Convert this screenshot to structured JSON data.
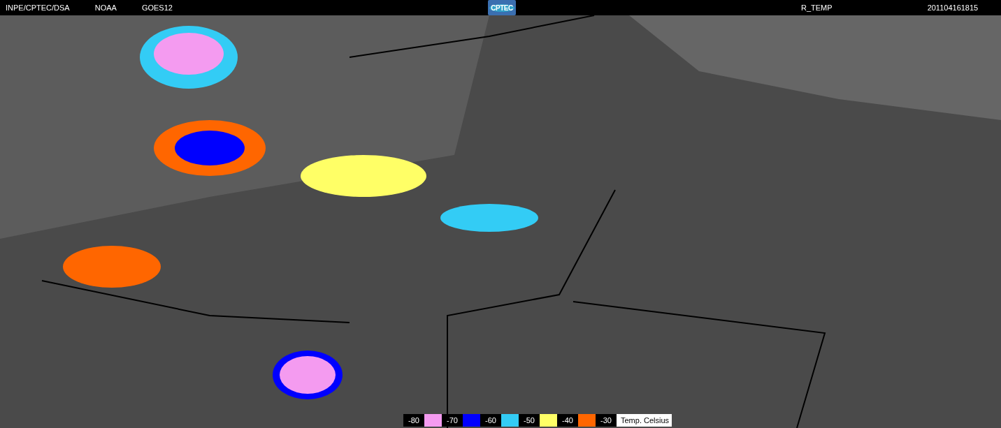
{
  "header": {
    "texts": [
      "INPE/CPTEC/DSA",
      "NOAA",
      "GOES12"
    ],
    "logo": "CPTEC",
    "product": "R_TEMP",
    "timestamp": "201104161815"
  },
  "legend": {
    "items": [
      {
        "label": "-80",
        "color": "#f49bf0"
      },
      {
        "label": "-70",
        "color": "#0000ff"
      },
      {
        "label": "-60",
        "color": "#33ccf5"
      },
      {
        "label": "-50",
        "color": "#ffff66"
      },
      {
        "label": "-40",
        "color": "#ff6600"
      },
      {
        "label": "-30"
      }
    ],
    "title": "Temp. Celsius"
  }
}
